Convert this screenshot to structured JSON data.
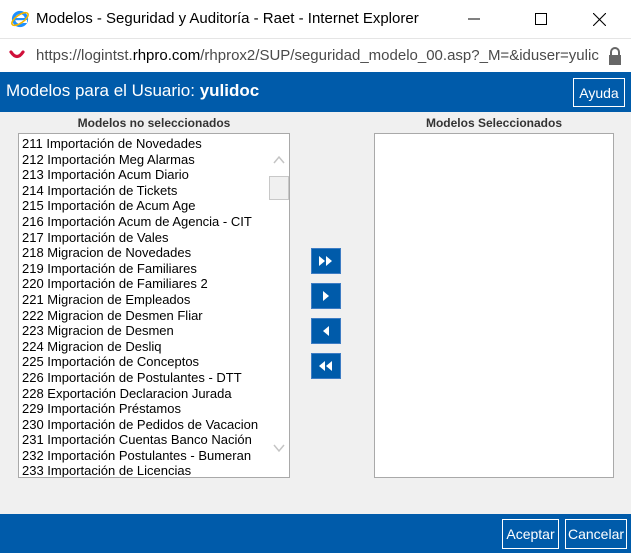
{
  "window": {
    "title": "Modelos - Seguridad y Auditoría - Raet - Internet Explorer",
    "icon": "internet-explorer-icon"
  },
  "address": {
    "prefix": "https://logintst.",
    "host": "rhpro.com",
    "path": "/rhprox2/SUP/seguridad_modelo_00.asp?_M=&iduser=yulic"
  },
  "header": {
    "title_prefix": "Modelos para el Usuario: ",
    "username": "yulidoc",
    "help_label": "Ayuda"
  },
  "lists": {
    "unselected_label": "Modelos no seleccionados",
    "selected_label": "Modelos Seleccionados",
    "unselected_items": [
      "211 Importación de Novedades",
      "212 Importación Meg Alarmas",
      "213 Importación Acum Diario",
      "214 Importación de Tickets",
      "215 Importación de Acum Age",
      "216 Importación Acum de Agencia - CIT",
      "217 Importación de Vales",
      "218 Migracion de Novedades",
      "219 Importación de Familiares",
      "220 Importación de Familiares 2",
      "221 Migracion de Empleados",
      "222 Migracion de Desmen Fliar",
      "223 Migracion de Desmen",
      "224 Migracion de Desliq",
      "225 Importación de Conceptos",
      "226 Importación de Postulantes - DTT",
      "228 Exportación Declaracion Jurada",
      "229 Importación Préstamos",
      "230 Importación de Pedidos de Vacacion",
      "231 Importación Cuentas Banco Nación",
      "232 Importación Postulantes - Bumeran",
      "233 Importación de Licencias"
    ],
    "selected_items": []
  },
  "footer": {
    "accept_label": "Aceptar",
    "cancel_label": "Cancelar"
  },
  "colors": {
    "accent": "#005baa"
  }
}
